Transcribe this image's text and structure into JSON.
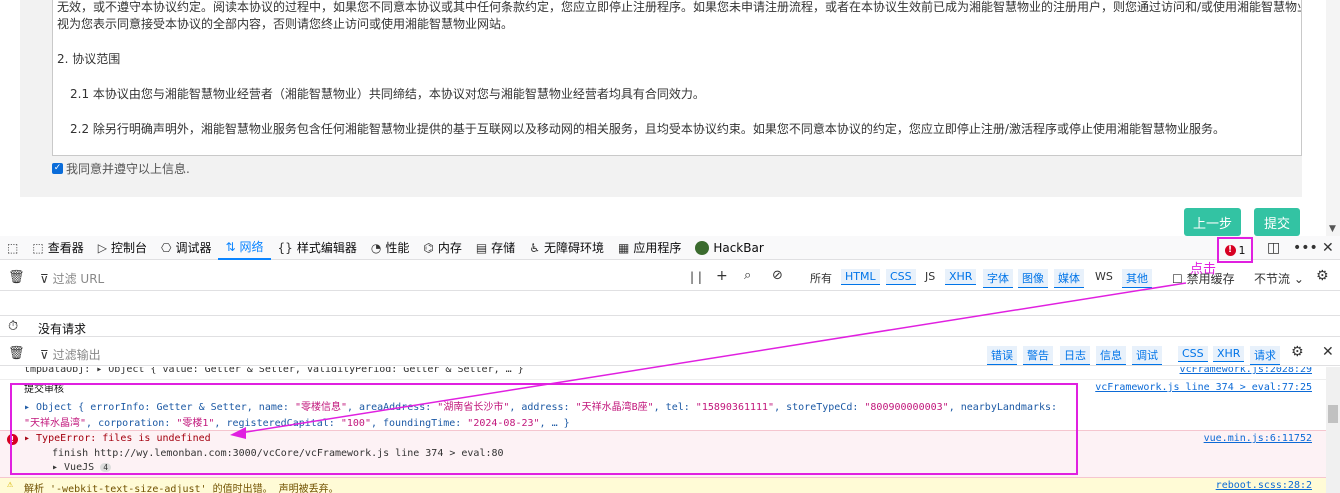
{
  "agreement": {
    "line1": "无效，或不遵守本协议约定。阅读本协议的过程中，如果您不同意本协议或其中任何条款约定，您应立即停止注册程序。如果您未申请注册流程，或者在本协议生效前已成为湘能智慧物业的注册用户，则您通过访问和/或使用湘能智慧物业，即",
    "line2": "视为您表示同意接受本协议的全部内容，否则请您终止访问或使用湘能智慧物业网站。",
    "line3": "2. 协议范围",
    "line4": "2.1 本协议由您与湘能智慧物业经营者（湘能智慧物业）共同缔结，本协议对您与湘能智慧物业经营者均具有合同效力。",
    "line5": "2.2 除另行明确声明外，湘能智慧物业服务包含任何湘能智慧物业提供的基于互联网以及移动网的相关服务，且均受本协议约束。如果您不同意本协议的约定，您应立即停止注册/激活程序或停止使用湘能智慧物业服务。",
    "agree_label": "我同意并遵守以上信息.",
    "checked": true
  },
  "buttons": {
    "prev": "上一步",
    "submit": "提交"
  },
  "devtools": {
    "tabs": [
      {
        "icon": "⬚",
        "label": "查看器"
      },
      {
        "icon": "▷",
        "label": "控制台"
      },
      {
        "icon": "⎔",
        "label": "调试器"
      },
      {
        "icon": "⇅",
        "label": "网络"
      },
      {
        "icon": "{}",
        "label": "样式编辑器"
      },
      {
        "icon": "◔",
        "label": "性能"
      },
      {
        "icon": "⌬",
        "label": "内存"
      },
      {
        "icon": "▤",
        "label": "存储"
      },
      {
        "icon": "♿",
        "label": "无障碍环境"
      },
      {
        "icon": "▦",
        "label": "应用程序"
      },
      {
        "icon": "",
        "label": "HackBar"
      }
    ],
    "selected_tab": "网络",
    "error_count": "1",
    "annotation": "点击",
    "network": {
      "filter_placeholder": "过滤 URL",
      "types": [
        "所有",
        "HTML",
        "CSS",
        "JS",
        "XHR",
        "字体",
        "图像",
        "媒体",
        "WS",
        "其他"
      ],
      "active_types": [
        "HTML",
        "CSS",
        "XHR",
        "字体",
        "图像",
        "媒体",
        "其他"
      ],
      "disable_cache": "禁用缓存",
      "throttle": "不节流 ⌄",
      "no_requests": "没有请求"
    },
    "console": {
      "filter_placeholder": "过滤输出",
      "levels": [
        "错误",
        "警告",
        "日志",
        "信息",
        "调试"
      ],
      "categories": [
        "CSS",
        "XHR",
        "请求"
      ],
      "rows": {
        "r1_text": "tmpDataObj: ▸ Object { value: Getter & Setter, validityPeriod: Getter & Setter, … }",
        "r1_src": "vcFramework.js:2028:29",
        "r2_label": "提交审核",
        "r2_src": "vcFramework.js line 374 > eval:77:25",
        "r2_obj1": "▸ Object { errorInfo: Getter & Setter, name: ",
        "r2_s1": "\"零楼信息\"",
        "r2_k2": ", areaAddress: ",
        "r2_s2": "\"湖南省长沙市\"",
        "r2_k3": ", address: ",
        "r2_s3": "\"天祥水晶湾B座\"",
        "r2_k4": ", tel: ",
        "r2_s4": "\"15890361111\"",
        "r2_k5": ", storeTypeCd: ",
        "r2_s5": "\"800900000003\"",
        "r2_k6": ", nearbyLandmarks:",
        "r2_s6": "\"天祥水晶湾\"",
        "r2_k7": ", corporation: ",
        "r2_s7": "\"零楼1\"",
        "r2_k8": ", registeredCapital: ",
        "r2_s8": "\"100\"",
        "r2_k9": ", foundingTime: ",
        "r2_s9": "\"2024-08-23\"",
        "r2_k10": ", … }",
        "err_text": "▸ TypeError: files is undefined",
        "err_src": "vue.min.js:6:11752",
        "err_finish": "finish  http://wy.lemonban.com:3000/vcCore/vcFramework.js line 374 > eval:80",
        "err_vuejs": "▸ VueJS",
        "err_vuejs_count": "4",
        "warn_text": "解析 '-webkit-text-size-adjust' 的值时出错。 声明被丢弃。",
        "warn_src": "reboot.scss:28:2"
      }
    }
  },
  "colors": {
    "accent": "#0a84ff",
    "annotation": "#e020e0",
    "button": "#33c3a3",
    "error": "#d70022"
  }
}
